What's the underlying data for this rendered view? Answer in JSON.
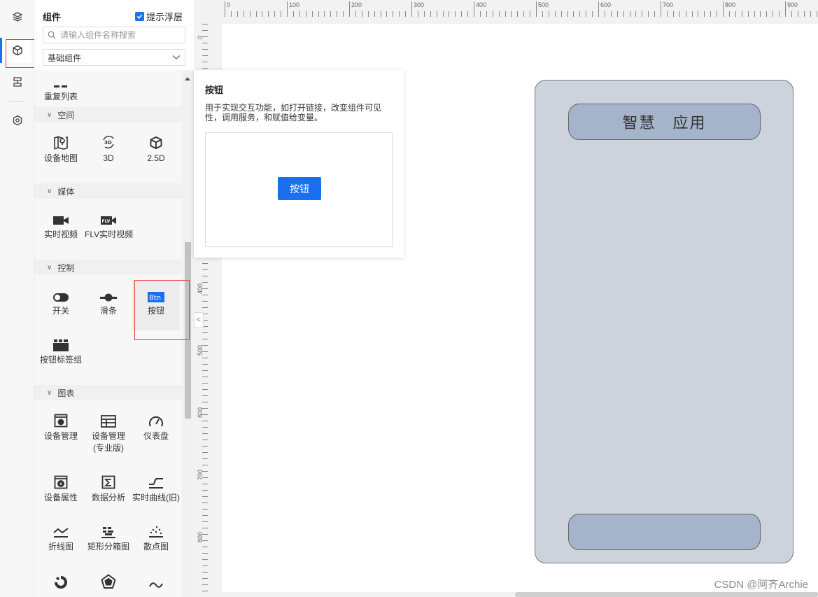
{
  "rail": {
    "items": [
      {
        "icon": "layers-icon",
        "active": false
      },
      {
        "icon": "cube-icon",
        "active": true
      },
      {
        "icon": "page-list-icon",
        "active": false
      },
      {
        "icon": "settings-hex-icon",
        "active": false
      }
    ]
  },
  "panel": {
    "title": "组件",
    "hint_label": "提示浮层",
    "hint_checked": true,
    "search_placeholder": "请输入组件名称搜索",
    "select_value": "基础组件",
    "top_item_label": "重复列表",
    "categories": {
      "space": "空间",
      "media": "媒体",
      "control": "控制",
      "chart": "图表"
    },
    "items": {
      "device_map": "设备地图",
      "three_d": "3D",
      "two_five_d": "2.5D",
      "live_video": "实时视频",
      "flv_video": "FLV实时视频",
      "switch": "开关",
      "slider": "滑条",
      "button": "按钮",
      "button_tabs": "按钮标签组",
      "device_mgmt": "设备管理",
      "device_mgmt_pro": "设备管理",
      "device_mgmt_pro_sub": "(专业版)",
      "gauge": "仪表盘",
      "device_attr": "设备属性",
      "data_analysis": "数据分析",
      "realtime_curve": "实时曲线(旧)",
      "line_chart": "折线图",
      "rect_box": "矩形分箱图",
      "scatter": "散点图"
    }
  },
  "tooltip": {
    "title": "按钮",
    "description": "用于实现交互功能，如打开链接，改变组件可见性，调用服务，和赋值给变量。",
    "preview_button": "按钮"
  },
  "ruler": {
    "top_labels": [
      "0",
      "100",
      "200",
      "300",
      "400",
      "500",
      "600",
      "700",
      "800",
      "900"
    ],
    "left_labels": [
      "0",
      "400",
      "500",
      "600",
      "700",
      "800"
    ]
  },
  "canvas": {
    "header_text": "智慧　应用",
    "footer_text": ""
  },
  "watermark": "CSDN @阿齐Archie"
}
